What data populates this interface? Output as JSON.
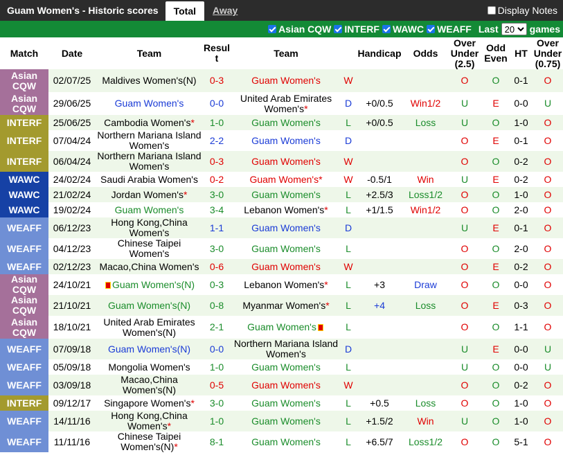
{
  "tabs": {
    "title": "Guam Women's - Historic scores",
    "total": "Total",
    "away": "Away",
    "display_notes": "Display Notes"
  },
  "filters": {
    "items": [
      "Asian CQW",
      "INTERF",
      "WAWC",
      "WEAFF"
    ],
    "last_label": "Last",
    "last_value": "20",
    "games_label": "games"
  },
  "headers": [
    "Match",
    "Date",
    "Team",
    "Result",
    "Team",
    "Handicap",
    "Odds",
    "Over Under (2.5)",
    "Odd Even",
    "HT",
    "Over Under (0.75)"
  ],
  "colors": {
    "asian": "#a5709a",
    "interf": "#a39a2e",
    "wawc": "#1641a5",
    "weaff": "#6f8fd5",
    "win": "#e00000",
    "draw": "#1a3bd6",
    "loss": "#1a8c2a"
  },
  "rows": [
    {
      "match": "Asian CQW",
      "cls": "m-asian",
      "date": "02/07/25",
      "home": "Maldives Women's(N)",
      "hc": "",
      "result": "0-3",
      "rc": "red",
      "away": "Guam Women's",
      "ac": "red",
      "wld": "W",
      "wc": "red",
      "handicap": "",
      "odds": "",
      "oc": "",
      "ou": "O",
      "oe": "O",
      "ht": "0-1",
      "ou2": "O"
    },
    {
      "match": "Asian CQW",
      "cls": "m-asian",
      "date": "29/06/25",
      "home": "Guam Women's",
      "hc": "blue",
      "result": "0-0",
      "rc": "blue",
      "away": "United Arab Emirates Women's",
      "ac": "",
      "astar": true,
      "wld": "D",
      "wc": "blue",
      "handicap": "+0/0.5",
      "odds": "Win1/2",
      "oc": "red",
      "ou": "U",
      "oe": "E",
      "ht": "0-0",
      "ou2": "U"
    },
    {
      "match": "INTERF",
      "cls": "m-interf",
      "date": "25/06/25",
      "home": "Cambodia Women's",
      "hc": "",
      "hstar": true,
      "result": "1-0",
      "rc": "green",
      "away": "Guam Women's",
      "ac": "green",
      "wld": "L",
      "wc": "green",
      "handicap": "+0/0.5",
      "odds": "Loss",
      "oc": "green",
      "ou": "U",
      "oe": "O",
      "ht": "1-0",
      "ou2": "O"
    },
    {
      "match": "INTERF",
      "cls": "m-interf",
      "date": "07/04/24",
      "home": "Northern Mariana Island Women's",
      "hc": "",
      "result": "2-2",
      "rc": "blue",
      "away": "Guam Women's",
      "ac": "blue",
      "wld": "D",
      "wc": "blue",
      "handicap": "",
      "odds": "",
      "oc": "",
      "ou": "O",
      "oe": "E",
      "ht": "0-1",
      "ou2": "O"
    },
    {
      "match": "INTERF",
      "cls": "m-interf",
      "date": "06/04/24",
      "home": "Northern Mariana Island Women's",
      "hc": "",
      "result": "0-3",
      "rc": "red",
      "away": "Guam Women's",
      "ac": "red",
      "wld": "W",
      "wc": "red",
      "handicap": "",
      "odds": "",
      "oc": "",
      "ou": "O",
      "oe": "O",
      "ht": "0-2",
      "ou2": "O"
    },
    {
      "match": "WAWC",
      "cls": "m-wawc",
      "date": "24/02/24",
      "home": "Saudi Arabia Women's",
      "hc": "",
      "result": "0-2",
      "rc": "red",
      "away": "Guam Women's",
      "ac": "red",
      "astar": true,
      "wld": "W",
      "wc": "red",
      "handicap": "-0.5/1",
      "odds": "Win",
      "oc": "red",
      "ou": "U",
      "oe": "E",
      "ht": "0-2",
      "ou2": "O"
    },
    {
      "match": "WAWC",
      "cls": "m-wawc",
      "date": "21/02/24",
      "home": "Jordan Women's",
      "hc": "",
      "hstar": true,
      "result": "3-0",
      "rc": "green",
      "away": "Guam Women's",
      "ac": "green",
      "wld": "L",
      "wc": "green",
      "handicap": "+2.5/3",
      "odds": "Loss1/2",
      "oc": "green",
      "ou": "O",
      "oe": "O",
      "ht": "1-0",
      "ou2": "O"
    },
    {
      "match": "WAWC",
      "cls": "m-wawc",
      "date": "19/02/24",
      "home": "Guam Women's",
      "hc": "green",
      "result": "3-4",
      "rc": "green",
      "away": "Lebanon Women's",
      "ac": "",
      "astar": true,
      "wld": "L",
      "wc": "green",
      "handicap": "+1/1.5",
      "odds": "Win1/2",
      "oc": "red",
      "ou": "O",
      "oe": "O",
      "ht": "2-0",
      "ou2": "O"
    },
    {
      "match": "WEAFF",
      "cls": "m-weaff",
      "date": "06/12/23",
      "home": "Hong Kong,China Women's",
      "hc": "",
      "result": "1-1",
      "rc": "blue",
      "away": "Guam Women's",
      "ac": "blue",
      "wld": "D",
      "wc": "blue",
      "handicap": "",
      "odds": "",
      "oc": "",
      "ou": "U",
      "oe": "E",
      "ht": "0-1",
      "ou2": "O"
    },
    {
      "match": "WEAFF",
      "cls": "m-weaff",
      "date": "04/12/23",
      "home": "Chinese Taipei Women's",
      "hc": "",
      "result": "3-0",
      "rc": "green",
      "away": "Guam Women's",
      "ac": "green",
      "wld": "L",
      "wc": "green",
      "handicap": "",
      "odds": "",
      "oc": "",
      "ou": "O",
      "oe": "O",
      "ht": "2-0",
      "ou2": "O"
    },
    {
      "match": "WEAFF",
      "cls": "m-weaff",
      "date": "02/12/23",
      "home": "Macao,China Women's",
      "hc": "",
      "result": "0-6",
      "rc": "red",
      "away": "Guam Women's",
      "ac": "red",
      "wld": "W",
      "wc": "red",
      "handicap": "",
      "odds": "",
      "oc": "",
      "ou": "O",
      "oe": "E",
      "ht": "0-2",
      "ou2": "O"
    },
    {
      "match": "Asian CQW",
      "cls": "m-asian",
      "date": "24/10/21",
      "home": "Guam Women's(N)",
      "hc": "green",
      "hflag": true,
      "result": "0-3",
      "rc": "green",
      "away": "Lebanon Women's",
      "ac": "",
      "astar": true,
      "wld": "L",
      "wc": "green",
      "handicap": "+3",
      "odds": "Draw",
      "oc": "blue",
      "ou": "O",
      "oe": "O",
      "ht": "0-0",
      "ou2": "O"
    },
    {
      "match": "Asian CQW",
      "cls": "m-asian",
      "date": "21/10/21",
      "home": "Guam Women's(N)",
      "hc": "green",
      "result": "0-8",
      "rc": "green",
      "away": "Myanmar Women's",
      "ac": "",
      "astar": true,
      "wld": "L",
      "wc": "green",
      "handicap": "+4",
      "odds": "Loss",
      "oc": "green",
      "hcolor": "blue",
      "ou": "O",
      "oe": "E",
      "ht": "0-3",
      "ou2": "O"
    },
    {
      "match": "Asian CQW",
      "cls": "m-asian",
      "date": "18/10/21",
      "home": "United Arab Emirates Women's(N)",
      "hc": "",
      "result": "2-1",
      "rc": "green",
      "away": "Guam Women's",
      "ac": "green",
      "aflag": true,
      "wld": "L",
      "wc": "green",
      "handicap": "",
      "odds": "",
      "oc": "",
      "ou": "O",
      "oe": "O",
      "ht": "1-1",
      "ou2": "O"
    },
    {
      "match": "WEAFF",
      "cls": "m-weaff",
      "date": "07/09/18",
      "home": "Guam Women's(N)",
      "hc": "blue",
      "result": "0-0",
      "rc": "blue",
      "away": "Northern Mariana Island Women's",
      "ac": "",
      "wld": "D",
      "wc": "blue",
      "handicap": "",
      "odds": "",
      "oc": "",
      "ou": "U",
      "oe": "E",
      "ht": "0-0",
      "ou2": "U"
    },
    {
      "match": "WEAFF",
      "cls": "m-weaff",
      "date": "05/09/18",
      "home": "Mongolia Women's",
      "hc": "",
      "result": "1-0",
      "rc": "green",
      "away": "Guam Women's",
      "ac": "green",
      "wld": "L",
      "wc": "green",
      "handicap": "",
      "odds": "",
      "oc": "",
      "ou": "U",
      "oe": "O",
      "ht": "0-0",
      "ou2": "U"
    },
    {
      "match": "WEAFF",
      "cls": "m-weaff",
      "date": "03/09/18",
      "home": "Macao,China Women's(N)",
      "hc": "",
      "result": "0-5",
      "rc": "red",
      "away": "Guam Women's",
      "ac": "red",
      "wld": "W",
      "wc": "red",
      "handicap": "",
      "odds": "",
      "oc": "",
      "ou": "O",
      "oe": "O",
      "ht": "0-2",
      "ou2": "O"
    },
    {
      "match": "INTERF",
      "cls": "m-interf",
      "date": "09/12/17",
      "home": "Singapore Women's",
      "hc": "",
      "hstar": true,
      "result": "3-0",
      "rc": "green",
      "away": "Guam Women's",
      "ac": "green",
      "wld": "L",
      "wc": "green",
      "handicap": "+0.5",
      "odds": "Loss",
      "oc": "green",
      "ou": "O",
      "oe": "O",
      "ht": "1-0",
      "ou2": "O"
    },
    {
      "match": "WEAFF",
      "cls": "m-weaff",
      "date": "14/11/16",
      "home": "Hong Kong,China Women's",
      "hc": "",
      "hstar": true,
      "result": "1-0",
      "rc": "green",
      "away": "Guam Women's",
      "ac": "green",
      "wld": "L",
      "wc": "green",
      "handicap": "+1.5/2",
      "odds": "Win",
      "oc": "red",
      "ou": "U",
      "oe": "O",
      "ht": "1-0",
      "ou2": "O"
    },
    {
      "match": "WEAFF",
      "cls": "m-weaff",
      "date": "11/11/16",
      "home": "Chinese Taipei Women's(N)",
      "hc": "",
      "hstar": true,
      "result": "8-1",
      "rc": "green",
      "away": "Guam Women's",
      "ac": "green",
      "wld": "L",
      "wc": "green",
      "handicap": "+6.5/7",
      "odds": "Loss1/2",
      "oc": "green",
      "ou": "O",
      "oe": "O",
      "ht": "5-1",
      "ou2": "O"
    }
  ]
}
